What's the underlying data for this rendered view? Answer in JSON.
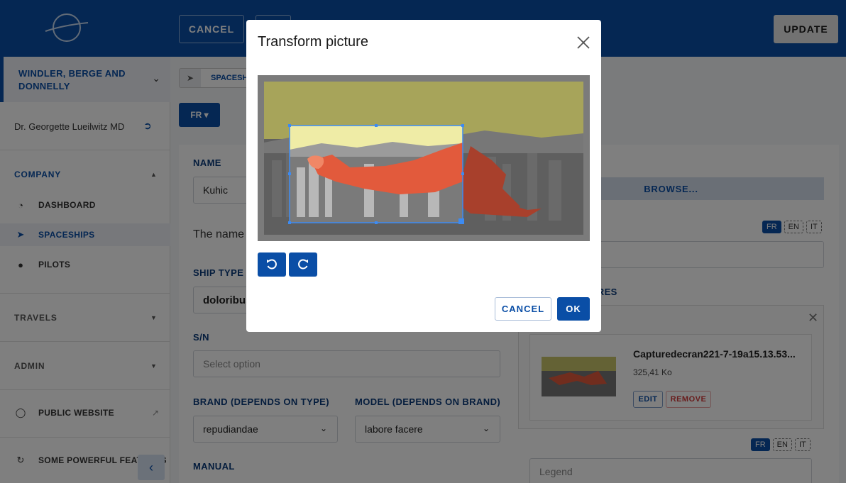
{
  "header": {
    "cancel_label": "CANCEL",
    "update_label": "UPDATE"
  },
  "sidebar": {
    "organization": "WINDLER, BERGE AND DONNELLY",
    "user": "Dr. Georgette Lueilwitz MD",
    "sections": [
      {
        "label": "COMPANY"
      },
      {
        "label": "TRAVELS"
      },
      {
        "label": "ADMIN"
      }
    ],
    "items": [
      {
        "label": "DASHBOARD",
        "icon": "gauge-icon"
      },
      {
        "label": "SPACESHIPS",
        "icon": "spaceship-icon"
      },
      {
        "label": "PILOTS",
        "icon": "user-icon"
      },
      {
        "label": "PUBLIC WEBSITE",
        "icon": "globe-icon"
      },
      {
        "label": "SOME POWERFUL FEATURES",
        "icon": "sync-icon"
      }
    ]
  },
  "breadcrumb": {
    "label": "SPACESHI"
  },
  "language": {
    "current": "FR"
  },
  "form": {
    "name_label": "NAME",
    "name_value": "Kuhic",
    "name_help": "The name",
    "ship_type_label": "SHIP TYPE",
    "ship_type_value": "doloribus",
    "sn_label": "S/N",
    "sn_placeholder": "Select option",
    "brand_label": "BRAND (DEPENDS ON TYPE)",
    "brand_value": "repudiandae",
    "model_label": "MODEL (DEPENDS ON BRAND)",
    "model_value": "labore facere",
    "manual_label": "MANUAL"
  },
  "right_panel": {
    "browse_label": "BROWSE...",
    "lang_tags": [
      "FR",
      "EN",
      "IT"
    ],
    "pictures_label": "URES",
    "picture": {
      "name": "Capturedecran221-7-19a15.13.53...",
      "size": "325,41 Ko",
      "edit_label": "EDIT",
      "remove_label": "REMOVE"
    },
    "legend_placeholder": "Legend"
  },
  "modal": {
    "title": "Transform picture",
    "cancel_label": "CANCEL",
    "ok_label": "OK"
  },
  "colors": {
    "primary": "#0a4ea6",
    "danger": "#d23b3b",
    "image_yellow": "#c9c46a",
    "image_red": "#e25a3c"
  }
}
